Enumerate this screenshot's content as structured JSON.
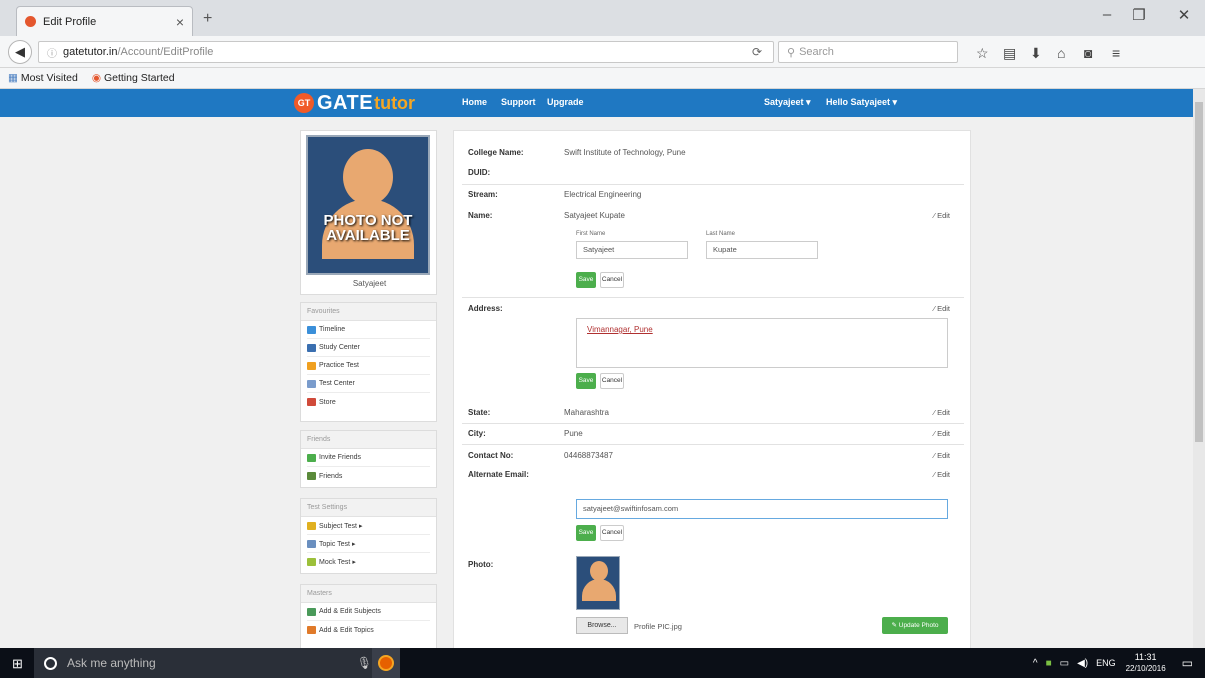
{
  "browser": {
    "tab_title": "Edit Profile",
    "url_host": "gatetutor.in",
    "url_path": "/Account/EditProfile",
    "search_placeholder": "Search",
    "bookmarks": [
      "Most Visited",
      "Getting Started"
    ]
  },
  "site": {
    "logo_gt": "GT",
    "logo_gate": "GATE",
    "logo_tutor": "tutor",
    "nav": [
      "Home",
      "Support",
      "Upgrade"
    ],
    "user_menu": "Satyajeet",
    "hello_menu": "Hello Satyajeet"
  },
  "sidebar": {
    "photo_text": "PHOTO NOT AVAILABLE",
    "username": "Satyajeet",
    "favourites": {
      "title": "Favourites",
      "items": [
        "Timeline",
        "Study Center",
        "Practice Test",
        "Test Center",
        "Store"
      ]
    },
    "friends": {
      "title": "Friends",
      "items": [
        "Invite Friends",
        "Friends"
      ]
    },
    "test_settings": {
      "title": "Test Settings",
      "items": [
        "Subject Test ▸",
        "Topic Test ▸",
        "Mock Test ▸"
      ]
    },
    "masters": {
      "title": "Masters",
      "items": [
        "Add & Edit Subjects",
        "Add & Edit Topics"
      ]
    }
  },
  "profile": {
    "college_label": "College Name:",
    "college_value": "Swift Institute of Technology, Pune",
    "duid_label": "DUID:",
    "stream_label": "Stream:",
    "stream_value": "Electrical Engineering",
    "name_label": "Name:",
    "name_value": "Satyajeet Kupate",
    "first_name_label": "First Name",
    "first_name_value": "Satyajeet",
    "last_name_label": "Last Name",
    "last_name_value": "Kupate",
    "address_label": "Address:",
    "address_value": "Vimannagar, Pune",
    "state_label": "State:",
    "state_value": "Maharashtra",
    "city_label": "City:",
    "city_value": "Pune",
    "contact_label": "Contact No:",
    "contact_value": "04468873487",
    "alt_email_label": "Alternate Email:",
    "alt_email_value": "satyajeet@swiftinfosam.com",
    "photo_label": "Photo:",
    "edit_label": "⁄ Edit",
    "save_label": "Save",
    "cancel_label": "Cancel",
    "browse_label": "Browse...",
    "file_name": "Profile PIC.jpg",
    "update_photo_label": "Update Photo"
  },
  "taskbar": {
    "search_placeholder": "Ask me anything",
    "lang": "ENG",
    "time": "11:31",
    "date": "22/10/2016"
  }
}
